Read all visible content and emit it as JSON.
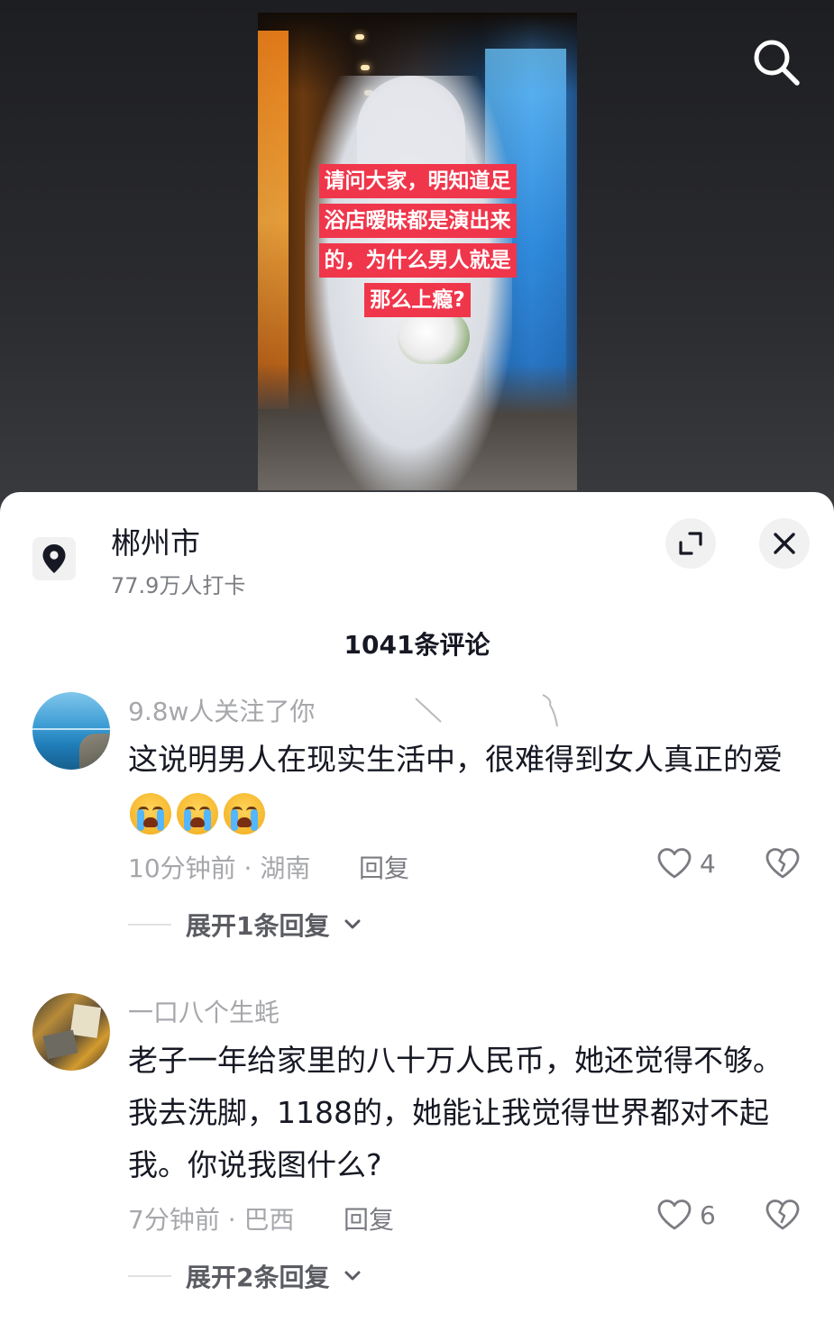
{
  "video": {
    "caption_lines": [
      "请问大家，明知道足",
      "浴店暧昧都是演出来",
      "的，为什么男人就是",
      "那么上瘾?"
    ],
    "search_icon": "search-icon"
  },
  "location": {
    "icon": "location-pin-icon",
    "name": "郴州市",
    "checkins": "77.9万人打卡"
  },
  "sheet_buttons": {
    "expand_icon": "expand-icon",
    "close_icon": "close-icon"
  },
  "comment_count": "1041条评论",
  "comments": [
    {
      "username": "9.8w人关注了你",
      "avatar": "sea-avatar",
      "text": "这说明男人在现实生活中，很难得到女人真正的爱",
      "emojis": [
        "loudly-crying-emoji",
        "loudly-crying-emoji",
        "loudly-crying-emoji"
      ],
      "time_location": "10分钟前 · 湖南",
      "reply_label": "回复",
      "likes": "4",
      "expand_label": "展开1条回复"
    },
    {
      "username": "一口八个生蚝",
      "avatar": "collage-avatar",
      "text": "老子一年给家里的八十万人民币，她还觉得不够。我去洗脚，1188的，她能让我觉得世界都对不起我。你说我图什么?",
      "time_location": "7分钟前 · 巴西",
      "reply_label": "回复",
      "likes": "6",
      "expand_label": "展开2条回复"
    }
  ],
  "colors": {
    "caption_bg": "#f0364b",
    "text_primary": "#161823",
    "text_secondary": "#a6a7ab"
  }
}
